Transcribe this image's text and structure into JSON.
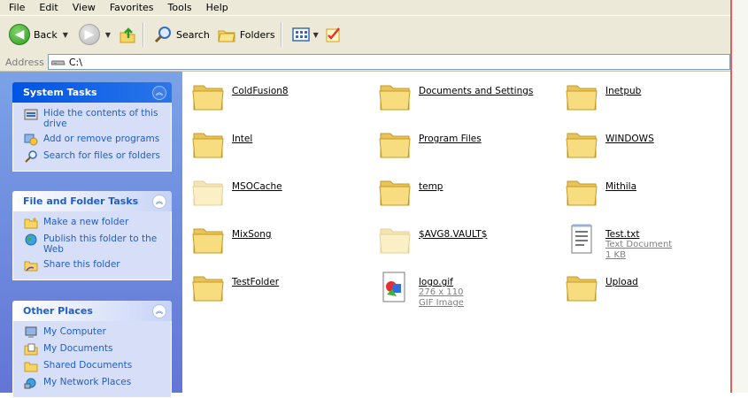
{
  "menu": [
    "File",
    "Edit",
    "View",
    "Favorites",
    "Tools",
    "Help"
  ],
  "toolbar": {
    "back_label": "Back",
    "search_label": "Search",
    "folders_label": "Folders"
  },
  "address": {
    "label": "Address",
    "value": "C:\\"
  },
  "tasks": {
    "system": {
      "title": "System Tasks",
      "items": [
        "Hide the contents of this drive",
        "Add or remove programs",
        "Search for files or folders"
      ]
    },
    "file_folder": {
      "title": "File and Folder Tasks",
      "items": [
        "Make a new folder",
        "Publish this folder to the Web",
        "Share this folder"
      ]
    },
    "other": {
      "title": "Other Places",
      "items": [
        "My Computer",
        "My Documents",
        "Shared Documents",
        "My Network Places"
      ]
    }
  },
  "files": [
    {
      "name": "ColdFusion8",
      "type": "folder"
    },
    {
      "name": "Documents and Settings",
      "type": "folder"
    },
    {
      "name": "Inetpub",
      "type": "folder"
    },
    {
      "name": "Intel",
      "type": "folder"
    },
    {
      "name": "Program Files",
      "type": "folder"
    },
    {
      "name": "WINDOWS",
      "type": "folder"
    },
    {
      "name": "MSOCache",
      "type": "folder-hidden"
    },
    {
      "name": "temp",
      "type": "folder"
    },
    {
      "name": "Mithila",
      "type": "folder"
    },
    {
      "name": "MixSong",
      "type": "folder"
    },
    {
      "name": "$AVG8.VAULT$",
      "type": "folder-hidden"
    },
    {
      "name": "Test.txt",
      "type": "text",
      "line1": "Text Document",
      "line2": "1 KB"
    },
    {
      "name": "TestFolder",
      "type": "folder"
    },
    {
      "name": "logo.gif",
      "type": "image",
      "line1": "276 x 110",
      "line2": "GIF Image"
    },
    {
      "name": "Upload",
      "type": "folder"
    }
  ]
}
